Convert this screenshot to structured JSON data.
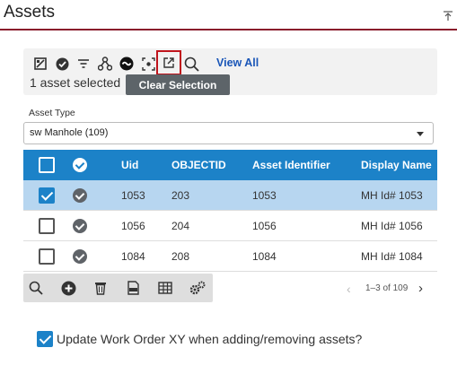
{
  "panel": {
    "title": "Assets"
  },
  "toolbar": {
    "icons": [
      "map-edit-icon",
      "check-circle-icon",
      "filter-icon",
      "relationship-icon",
      "reshape-icon",
      "zoom-to-selection-icon",
      "open-external-icon",
      "search-icon"
    ],
    "view_all_label": "View All",
    "selected_text": "1 asset selected",
    "tooltip": "Clear Selection"
  },
  "asset_type": {
    "label": "Asset Type",
    "value": "sw Manhole (109)"
  },
  "table": {
    "columns": [
      "Uid",
      "OBJECTID",
      "Asset Identifier",
      "Display Name"
    ],
    "rows": [
      {
        "uid": "1053",
        "objectid": "203",
        "asset_id": "1053",
        "display_name": "MH Id# 1053",
        "selected": true
      },
      {
        "uid": "1056",
        "objectid": "204",
        "asset_id": "1056",
        "display_name": "MH Id# 1056",
        "selected": false
      },
      {
        "uid": "1084",
        "objectid": "208",
        "asset_id": "1084",
        "display_name": "MH Id# 1084",
        "selected": false
      }
    ]
  },
  "bottom_toolbar": {
    "icons": [
      "search-icon",
      "add-icon",
      "delete-icon",
      "export-icon",
      "table-icon",
      "settings-icon"
    ]
  },
  "pager": {
    "prev": "‹",
    "text": "1–3 of 109",
    "next": "›"
  },
  "update_option": {
    "label": "Update Work Order XY when adding/removing assets?",
    "checked": true
  },
  "colors": {
    "accent": "#1c82c8",
    "header_border": "#8a1c2b",
    "selected_row": "#b7d6f0",
    "highlight_border": "#c0141c"
  }
}
